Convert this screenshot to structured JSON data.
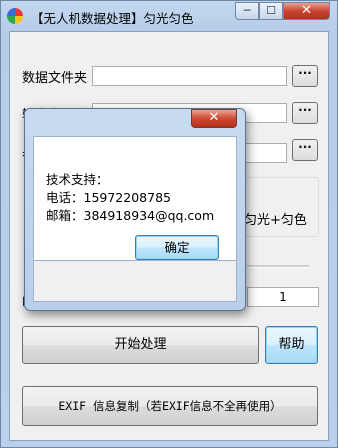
{
  "window": {
    "title": "【无人机数据处理】匀光匀色",
    "minimize_glyph": "─",
    "maximize_glyph": "☐",
    "close_glyph": "✕"
  },
  "form": {
    "data_folder_label": "数据文件夹",
    "data_folder_value": "",
    "output_folder_label": "输出文件夹",
    "output_folder_value": "",
    "third_label": "参",
    "third_value": "",
    "browse_label": "···",
    "mode_option": "匀光+匀色",
    "number_value": "1",
    "left_cut_label": "阈"
  },
  "buttons": {
    "start": "开始处理",
    "help": "帮助",
    "exif": "EXIF 信息复制（若EXIF信息不全再使用）"
  },
  "dialog": {
    "close_glyph": "✕",
    "support_label": "技术支持：",
    "phone_line": "电话：15972208785",
    "email_line": "邮箱：384918934@qq.com",
    "ok_label": "确定"
  },
  "icons": {
    "app": "color-wheel-icon"
  }
}
